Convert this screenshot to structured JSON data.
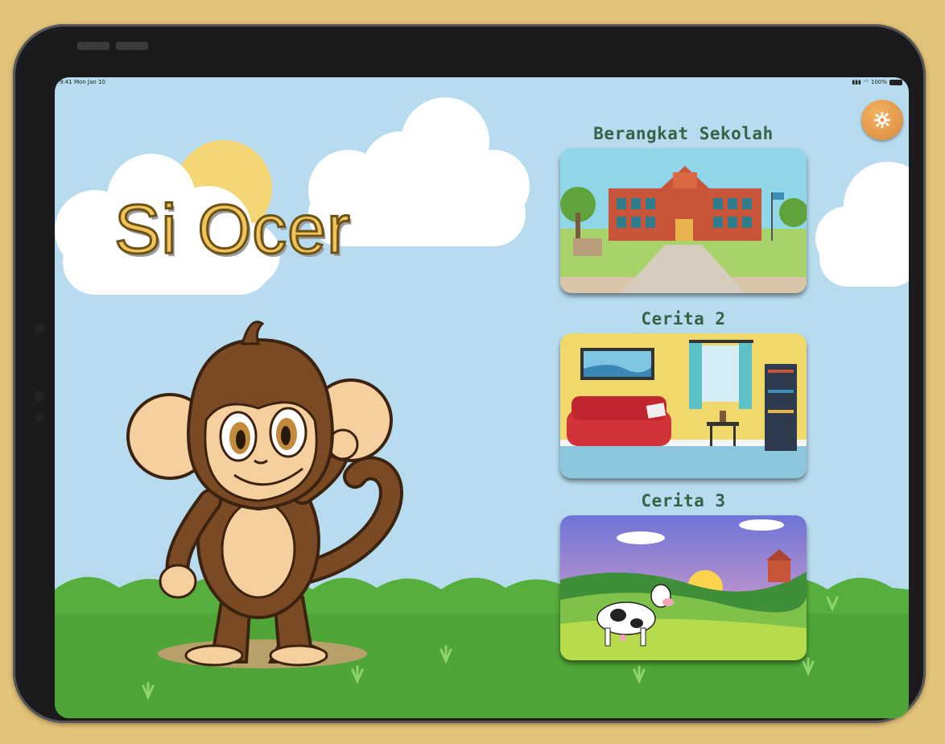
{
  "status_bar": {
    "time": "9:41 Mon Jan 10",
    "battery": "100%"
  },
  "app": {
    "title": "Si Ocer"
  },
  "settings": {
    "icon": "gear-icon",
    "color": "#E39A48"
  },
  "stories": [
    {
      "title": "Berangkat Sekolah",
      "scene": "school"
    },
    {
      "title": "Cerita 2",
      "scene": "living-room"
    },
    {
      "title": "Cerita 3",
      "scene": "farm-with-cow"
    }
  ],
  "colors": {
    "background": "#E3C279",
    "sky": "#B7DCEF",
    "grass": "#53A93A",
    "title_fill": "#F2C35A",
    "story_title": "#3A6046"
  }
}
